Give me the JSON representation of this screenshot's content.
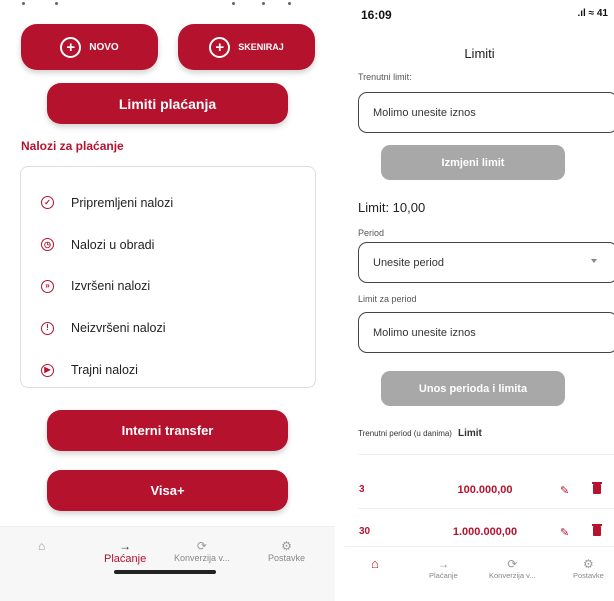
{
  "left": {
    "buttons": {
      "novo": "NOVO",
      "skeniraj": "SKENIRAJ",
      "limits": "Limiti plaćanja",
      "interni": "Interni transfer",
      "visa": "Visa+"
    },
    "section_title": "Nalozi za plaćanje",
    "orders": [
      {
        "label": "Pripremljeni nalozi",
        "icon": "check-circle-icon",
        "glyph": "✓"
      },
      {
        "label": "Nalozi u obradi",
        "icon": "clock-icon",
        "glyph": "◷"
      },
      {
        "label": "Izvršeni nalozi",
        "icon": "double-chevron-icon",
        "glyph": "»"
      },
      {
        "label": "Neizvršeni nalozi",
        "icon": "alert-icon",
        "glyph": "!"
      },
      {
        "label": "Trajni nalozi",
        "icon": "play-icon",
        "glyph": "▶"
      }
    ],
    "nav": {
      "home_icon": "⌂",
      "payment_icon": "→",
      "payment_label": "Plaćanje",
      "conversion_icon": "⟳",
      "conversion_label": "Konverzija v...",
      "settings_icon": "⚙",
      "settings_label": "Postavke"
    }
  },
  "right": {
    "status": {
      "time": "16:09",
      "icons": ".ıl ≈ 41"
    },
    "title": "Limiti",
    "current_limit_label": "Trenutni limit:",
    "current_limit_placeholder": "Molimo unesite iznos",
    "change_limit_button": "Izmjeni limit",
    "limit_value": "Limit: 10,00",
    "period_label": "Period",
    "period_placeholder": "Unesite period",
    "period_limit_label": "Limit za period",
    "period_limit_placeholder": "Molimo unesite iznos",
    "submit_button": "Unos perioda i limita",
    "table_header_period": "Trenutni period (u danima)",
    "table_header_limit": "Limit",
    "rows": [
      {
        "period": "3",
        "limit": "100.000,00"
      },
      {
        "period": "30",
        "limit": "1.000.000,00"
      }
    ],
    "nav": {
      "home_icon": "⌂",
      "payment_icon": "→",
      "payment_label": "Plaćanje",
      "conversion_icon": "⟳",
      "conversion_label": "Konverzija v...",
      "settings_icon": "⚙",
      "settings_label": "Postavke"
    }
  },
  "colors": {
    "brand_red": "#b5122e",
    "disabled_grey": "#a8a8a8"
  }
}
